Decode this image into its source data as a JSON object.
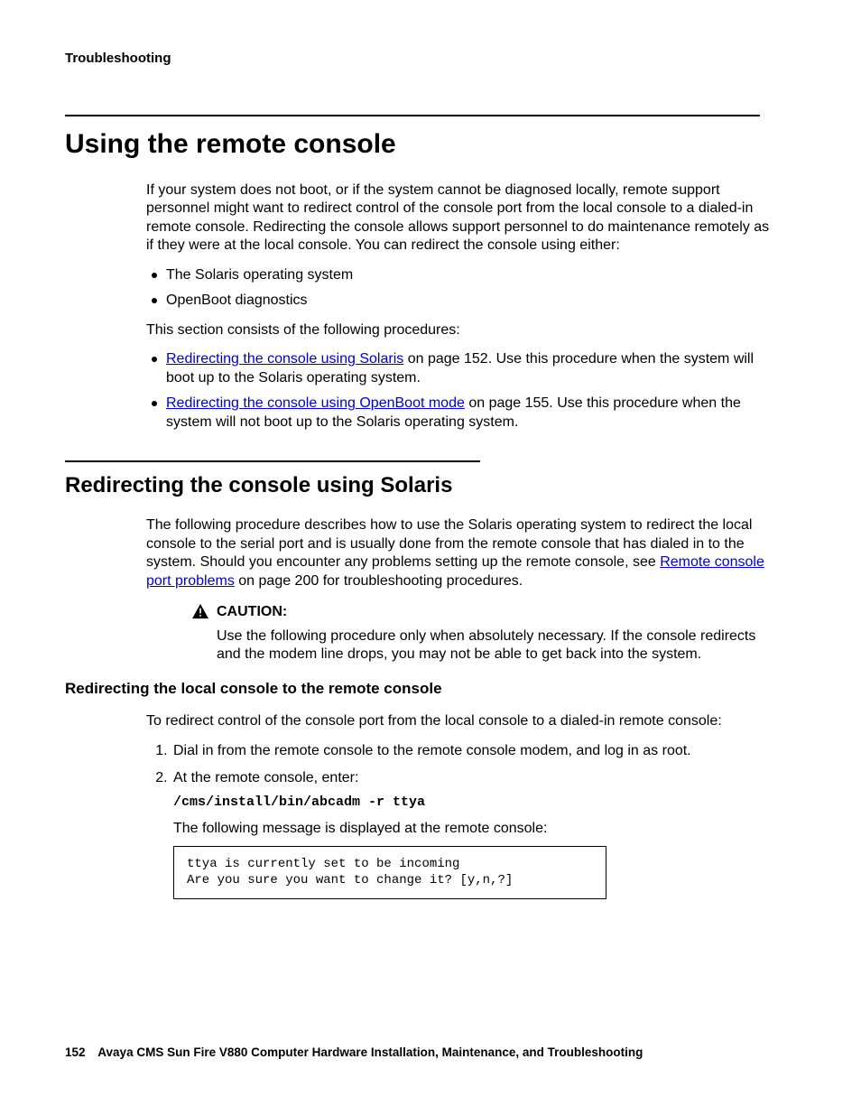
{
  "running_head": "Troubleshooting",
  "h1": "Using the remote console",
  "intro": "If your system does not boot, or if the system cannot be diagnosed locally, remote support personnel might want to redirect control of the console port from the local console to a dialed-in remote console. Redirecting the console allows support personnel to do maintenance remotely as if they were at the local console. You can redirect the console using either:",
  "intro_bullets": [
    "The Solaris operating system",
    "OpenBoot diagnostics"
  ],
  "proc_lead": "This section consists of the following procedures:",
  "proc_items": [
    {
      "link": "Redirecting the console using Solaris",
      "rest": " on page 152. Use this procedure when the system will boot up to the Solaris operating system."
    },
    {
      "link": "Redirecting the console using OpenBoot mode",
      "rest": " on page 155. Use this procedure when the system will not boot up to the Solaris operating system."
    }
  ],
  "h2": "Redirecting the console using Solaris",
  "h2_para_pre": "The following procedure describes how to use the Solaris operating system to redirect the local console to the serial port and is usually done from the remote console that has dialed in to the system. Should you encounter any problems setting up the remote console, see ",
  "h2_link": "Remote console port problems",
  "h2_para_post": " on page 200 for troubleshooting procedures.",
  "caution_label": "CAUTION:",
  "caution_body": "Use the following procedure only when absolutely necessary. If the console redirects and the modem line drops, you may not be able to get back into the system.",
  "h3": "Redirecting the local console to the remote console",
  "h3_lead": "To redirect control of the console port from the local console to a dialed-in remote console:",
  "steps": {
    "s1": "Dial in from the remote console to the remote console modem, and log in as root.",
    "s2_lead": "At the remote console, enter:",
    "s2_cmd": "/cms/install/bin/abcadm -r ttya",
    "s2_after": "The following message is displayed at the remote console:",
    "s2_console_l1": "ttya is currently set to be incoming",
    "s2_console_l2": "Are you sure you want to change it? [y,n,?]"
  },
  "footer": {
    "page": "152",
    "title": "Avaya CMS Sun Fire V880 Computer Hardware Installation, Maintenance, and Troubleshooting"
  }
}
